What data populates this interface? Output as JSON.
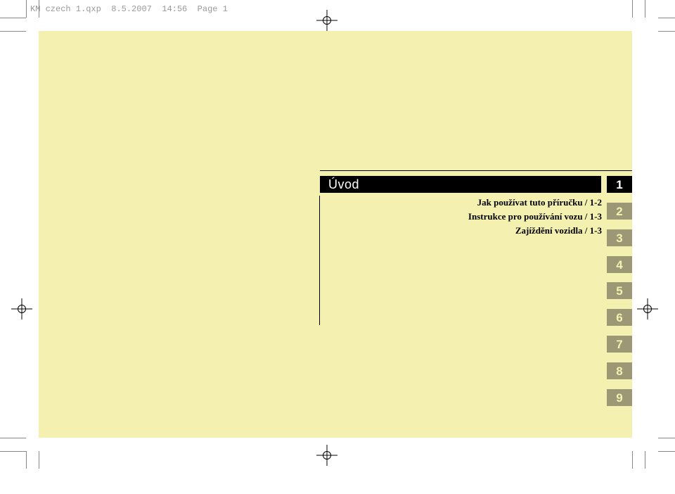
{
  "header": {
    "filename": "KM czech 1.qxp",
    "date": "8.5.2007",
    "time": "14:56",
    "page_label": "Page 1"
  },
  "section_title": "Úvod",
  "toc": [
    "Jak používat tuto příručku / 1-2",
    "Instrukce pro používání vozu / 1-3",
    "Zajíždění vozidla / 1-3"
  ],
  "tabs": [
    "1",
    "2",
    "3",
    "4",
    "5",
    "6",
    "7",
    "8",
    "9"
  ]
}
